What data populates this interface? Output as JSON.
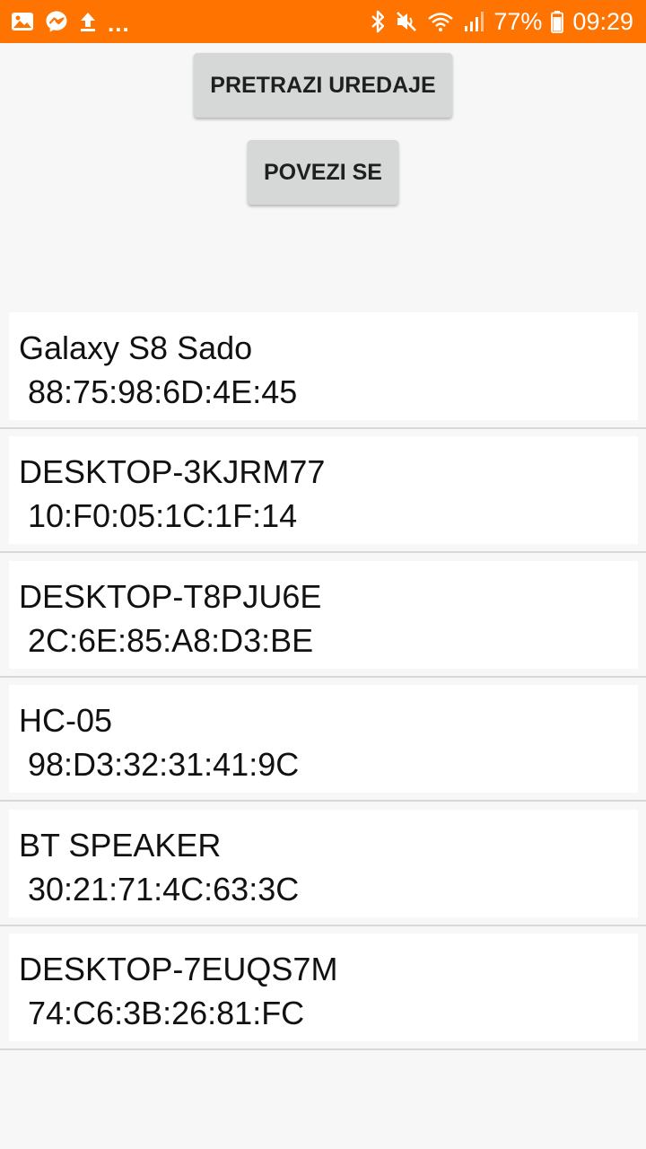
{
  "status_bar": {
    "left_icons": [
      "gallery-icon",
      "messenger-icon",
      "upload-icon"
    ],
    "overflow": "...",
    "right_icons": [
      "bluetooth-icon",
      "mute-icon",
      "wifi-icon",
      "signal-icon"
    ],
    "battery_percent": "77%",
    "time": "09:29",
    "background_color": "#ff7300"
  },
  "buttons": {
    "search_label": "PRETRAZI UREDAJE",
    "connect_label": "POVEZI SE"
  },
  "devices": [
    {
      "name": "Galaxy S8 Sado",
      "mac": " 88:75:98:6D:4E:45"
    },
    {
      "name": "DESKTOP-3KJRM77",
      "mac": " 10:F0:05:1C:1F:14"
    },
    {
      "name": "DESKTOP-T8PJU6E",
      "mac": " 2C:6E:85:A8:D3:BE"
    },
    {
      "name": "HC-05",
      "mac": " 98:D3:32:31:41:9C"
    },
    {
      "name": "BT SPEAKER",
      "mac": " 30:21:71:4C:63:3C"
    },
    {
      "name": "DESKTOP-7EUQS7M",
      "mac": " 74:C6:3B:26:81:FC"
    }
  ]
}
